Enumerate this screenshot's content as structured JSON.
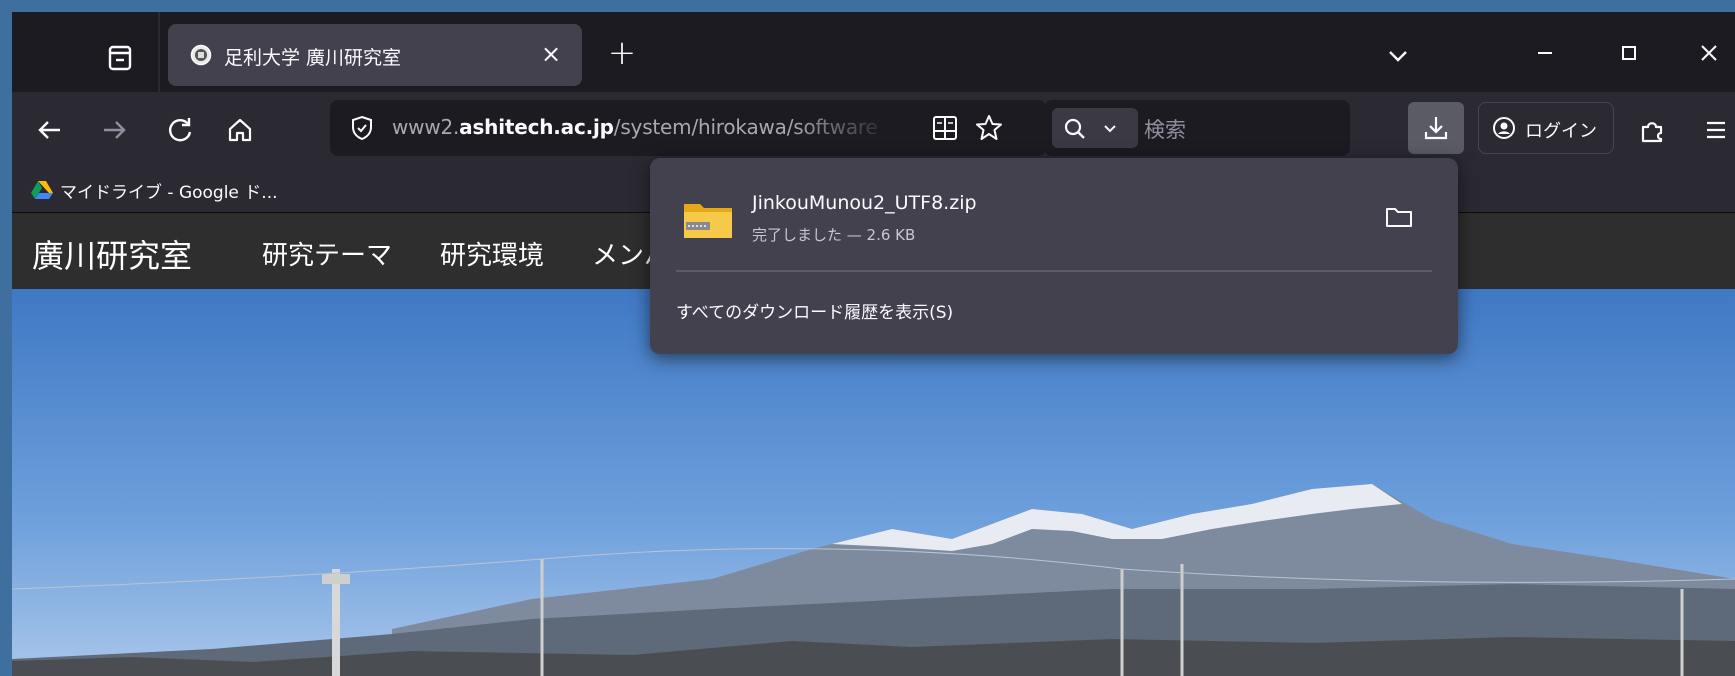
{
  "tab": {
    "title": "足利大学 廣川研究室",
    "close_glyph": "×"
  },
  "tabbar": {
    "new_tab_glyph": "+"
  },
  "navbar": {
    "url_prefix": "www2.",
    "url_domain": "ashitech.ac.jp",
    "url_path": "/system/hirokawa/software",
    "search_placeholder": "検索",
    "login_label": "ログイン"
  },
  "bookmarks": {
    "items": [
      {
        "label": "マイドライブ - Google ド..."
      }
    ]
  },
  "site": {
    "title": "廣川研究室",
    "nav": [
      "研究テーマ",
      "研究環境",
      "メンバ"
    ]
  },
  "downloads": {
    "file_name": "JinkouMunou2_UTF8.zip",
    "status": "完了しました — 2.6 KB",
    "show_all_label": "すべてのダウンロード履歴を表示(S)"
  },
  "icons": {
    "tab_list": "tab-list-icon",
    "favicon": "university-favicon-icon",
    "back": "back-arrow-icon",
    "forward": "forward-arrow-icon",
    "reload": "reload-icon",
    "home": "home-icon",
    "tracking": "shield-icon",
    "reader": "reader-view-icon",
    "bookmark": "star-icon",
    "search": "search-icon",
    "download": "download-icon",
    "account": "account-icon",
    "extensions": "extensions-icon",
    "menu": "hamburger-menu-icon",
    "folder": "folder-icon"
  },
  "colors": {
    "tabbar_bg": "#1c1b22",
    "navbar_bg": "#2b2a33",
    "active_tab": "#42414d",
    "panel_bg": "#42414d",
    "site_nav_bg": "#2e2e2e",
    "sky": "#4f87cc"
  }
}
